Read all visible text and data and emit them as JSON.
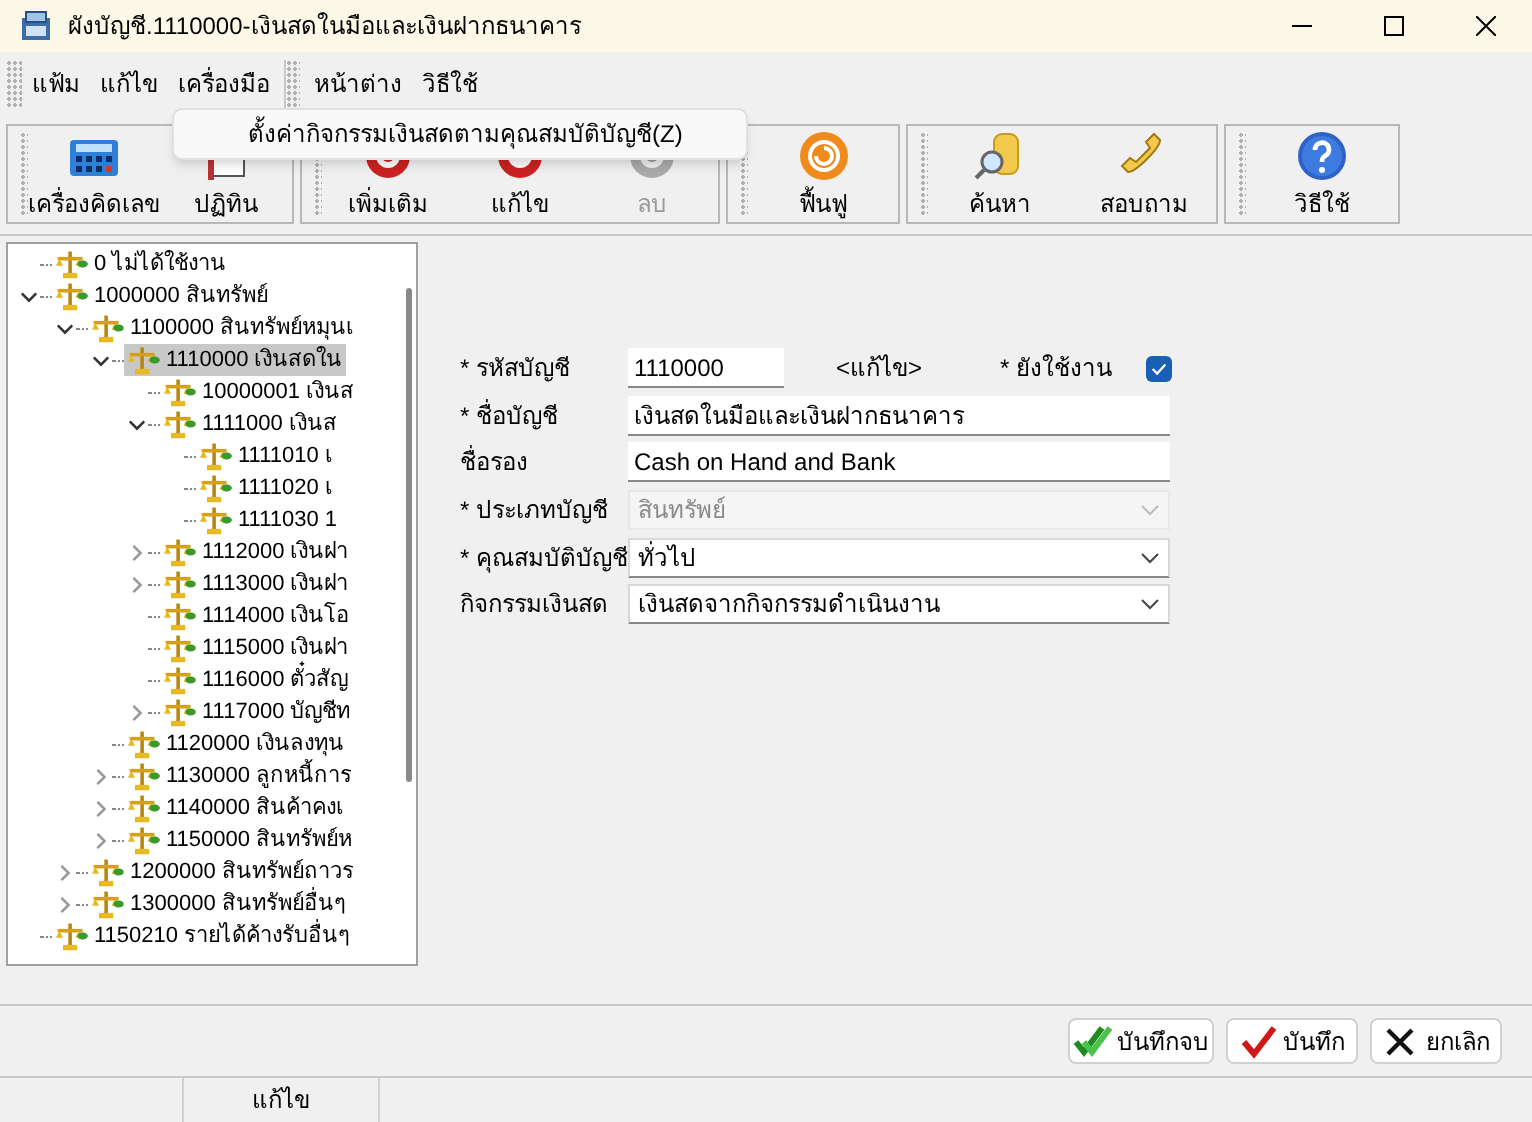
{
  "window": {
    "title": "ผังบัญชี.1110000-เงินสดในมือและเงินฝากธนาคาร"
  },
  "menu": [
    [
      "แฟ้ม",
      "แก้ไข",
      "เครื่องมือ"
    ],
    [
      "หน้าต่าง",
      "วิธีใช้"
    ]
  ],
  "open_menu": {
    "items": [
      "ตั้งค่ากิจกรรมเงินสดตามคุณสมบัติบัญชี(Z)"
    ]
  },
  "toolbar": [
    [
      {
        "label": "เครื่องคิดเลข",
        "kind": "calculator",
        "disabled": false
      },
      {
        "label": "ปฏิทิน",
        "kind": "calendar",
        "disabled": false
      }
    ],
    [
      {
        "label": "เพิ่มเติม",
        "kind": "add",
        "disabled": false
      },
      {
        "label": "แก้ไข",
        "kind": "edit",
        "disabled": false
      },
      {
        "label": "ลบ",
        "kind": "delete",
        "disabled": true
      }
    ],
    [
      {
        "label": "ฟื้นฟู",
        "kind": "refresh",
        "disabled": false
      }
    ],
    [
      {
        "label": "ค้นหา",
        "kind": "search",
        "disabled": false
      },
      {
        "label": "สอบถาม",
        "kind": "phone",
        "disabled": false
      }
    ],
    [
      {
        "label": "วิธีใช้",
        "kind": "help",
        "disabled": false
      }
    ]
  ],
  "tree": [
    {
      "label": "0 ไม่ได้ใช้งาน",
      "selected": false
    },
    {
      "label": "1000000 สินทรัพย์",
      "selected": false,
      "expanded": true,
      "children": [
        {
          "label": "1100000 สินทรัพย์หมุนเ",
          "selected": false,
          "expanded": true,
          "children": [
            {
              "label": "1110000 เงินสดใน",
              "selected": true,
              "expanded": true,
              "children": [
                {
                  "label": "10000001 เงินส",
                  "selected": false
                },
                {
                  "label": "1111000 เงินส",
                  "selected": false,
                  "expanded": true,
                  "children": [
                    {
                      "label": "1111010 เ",
                      "selected": false
                    },
                    {
                      "label": "1111020 เ",
                      "selected": false
                    },
                    {
                      "label": "1111030 1",
                      "selected": false
                    }
                  ]
                },
                {
                  "label": "1112000 เงินฝา",
                  "selected": false,
                  "expanded": false
                },
                {
                  "label": "1113000 เงินฝา",
                  "selected": false,
                  "expanded": false
                },
                {
                  "label": "1114000 เงินโอ",
                  "selected": false
                },
                {
                  "label": "1115000 เงินฝา",
                  "selected": false
                },
                {
                  "label": "1116000 ตั๋วสัญ",
                  "selected": false
                },
                {
                  "label": "1117000 บัญชีท",
                  "selected": false,
                  "expanded": false
                }
              ]
            },
            {
              "label": "1120000 เงินลงทุน",
              "selected": false
            },
            {
              "label": "1130000 ลูกหนี้การ",
              "selected": false,
              "expanded": false
            },
            {
              "label": "1140000 สินค้าคงเ",
              "selected": false,
              "expanded": false
            },
            {
              "label": "1150000 สินทรัพย์ห",
              "selected": false,
              "expanded": false
            }
          ]
        },
        {
          "label": "1200000 สินทรัพย์ถาวร",
          "selected": false,
          "expanded": false
        },
        {
          "label": "1300000 สินทรัพย์อื่นๆ",
          "selected": false,
          "expanded": false
        }
      ]
    },
    {
      "label": "1150210 รายได้ค้างรับอื่นๆ",
      "selected": false
    }
  ],
  "form": {
    "code": {
      "label": "* รหัสบัญชี",
      "value": "1110000"
    },
    "mode": "<แก้ไข>",
    "active": {
      "label": "* ยังใช้งาน",
      "checked": true
    },
    "fields": [
      {
        "label": "* ชื่อบัญชี",
        "kind": "text",
        "value": "เงินสดในมือและเงินฝากธนาคาร",
        "disabled": false
      },
      {
        "label": "ชื่อรอง",
        "kind": "text",
        "value": "Cash on Hand and Bank",
        "disabled": false
      },
      {
        "label": "* ประเภทบัญชี",
        "kind": "select",
        "value": "สินทรัพย์",
        "disabled": true
      },
      {
        "label": "* คุณสมบัติบัญชี",
        "kind": "select",
        "value": "ทั่วไป",
        "disabled": false
      },
      {
        "label": "กิจกรรมเงินสด",
        "kind": "select",
        "value": "เงินสดจากกิจกรรมดำเนินงาน",
        "disabled": false
      }
    ]
  },
  "buttons": [
    {
      "label": "บันทึกจบ",
      "kind": "save-close"
    },
    {
      "label": "บันทึก",
      "kind": "save"
    },
    {
      "label": "ยกเลิก",
      "kind": "cancel"
    }
  ],
  "status_bar": {
    "mode": "แก้ไข"
  }
}
